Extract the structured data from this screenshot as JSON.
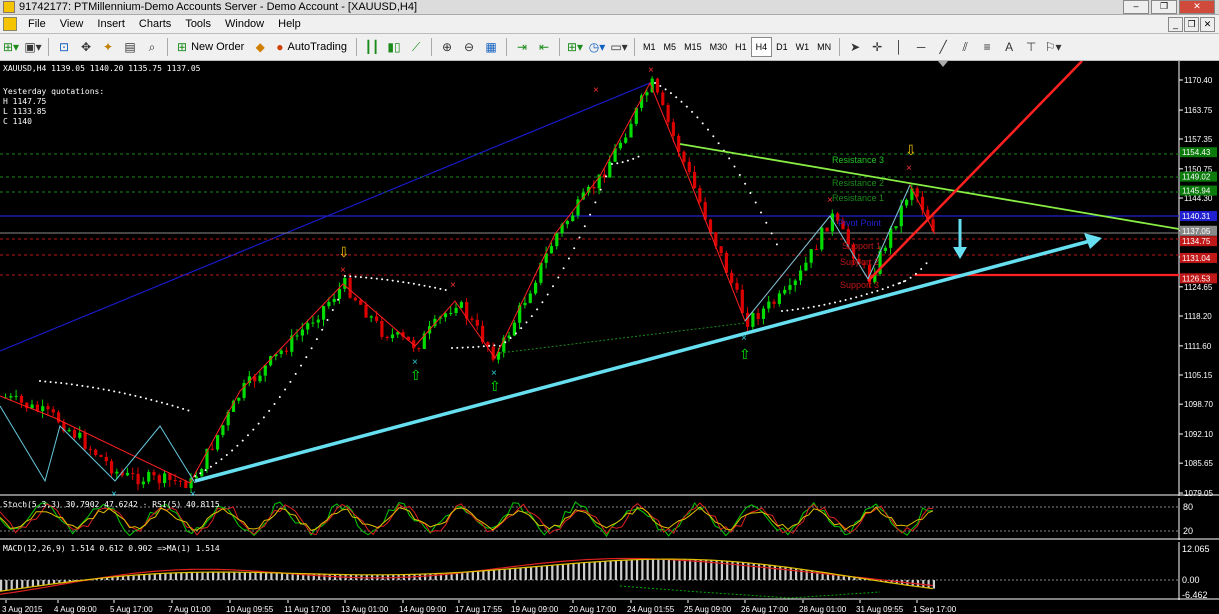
{
  "window": {
    "title": "91742177: PTMillennium-Demo Accounts Server - Demo Account - [XAUUSD,H4]"
  },
  "menu": {
    "items": [
      "File",
      "View",
      "Insert",
      "Charts",
      "Tools",
      "Window",
      "Help"
    ]
  },
  "toolbar": {
    "new_order": "New Order",
    "autotrading": "AutoTrading",
    "timeframes": [
      "M1",
      "M5",
      "M15",
      "M30",
      "H1",
      "H4",
      "D1",
      "W1",
      "MN"
    ],
    "active_timeframe": "H4"
  },
  "chart": {
    "header": "XAUUSD,H4  1139.05 1140.20 1135.75 1137.05",
    "yesterday": {
      "title": "Yesterday quotations:",
      "h": "H 1147.75",
      "l": "L 1133.85",
      "c": "C 1140"
    },
    "price_axis": [
      "1170.40",
      "1163.75",
      "1157.35",
      "1150.75",
      "1144.30",
      "1137.05",
      "1131.25",
      "1124.65",
      "1118.20",
      "1111.60",
      "1105.15",
      "1098.70",
      "1092.10",
      "1085.65",
      "1079.05"
    ],
    "price_tags": [
      {
        "value": "1154.43",
        "color": "#0a7a0a"
      },
      {
        "value": "1149.02",
        "color": "#0a7a0a"
      },
      {
        "value": "1145.94",
        "color": "#0a7a0a"
      },
      {
        "value": "1140.31",
        "color": "#2020d0"
      },
      {
        "value": "1137.05",
        "color": "#8a8a8a"
      },
      {
        "value": "1134.75",
        "color": "#c01818"
      },
      {
        "value": "1131.04",
        "color": "#c01818"
      },
      {
        "value": "1126.53",
        "color": "#c01818"
      }
    ],
    "level_labels": [
      "Resistance 3",
      "Resistance 2",
      "Resistance 1",
      "Pivot Point",
      "Support 1",
      "Support 2",
      "Support 3"
    ],
    "time_axis": [
      "3 Aug 2015",
      "4 Aug 09:00",
      "5 Aug 17:00",
      "7 Aug 01:00",
      "10 Aug 09:55",
      "11 Aug 17:00",
      "13 Aug 01:00",
      "14 Aug 09:00",
      "17 Aug 17:55",
      "19 Aug 09:00",
      "20 Aug 17:00",
      "24 Aug 01:55",
      "25 Aug 09:00",
      "26 Aug 17:00",
      "28 Aug 01:00",
      "31 Aug 09:55",
      "1 Sep 17:00"
    ],
    "colors": {
      "bull": "#00dd00",
      "bear": "#dd0000",
      "support_line": "#00ccee",
      "resistance_line": "#88ee44",
      "trend_red": "#ff2020",
      "channel_blue": "#1a1acc"
    }
  },
  "stoch": {
    "label": "Stoch(5,3,3) 30.7902 47.6242 · RSI(5) 40.8115",
    "axis": [
      "80",
      "20"
    ]
  },
  "macd": {
    "label": "MACD(12,26,9) 1.514 0.612 0.902  =>MA(1) 1.514",
    "axis": [
      "12.065",
      "0.00",
      "-6.462"
    ]
  }
}
